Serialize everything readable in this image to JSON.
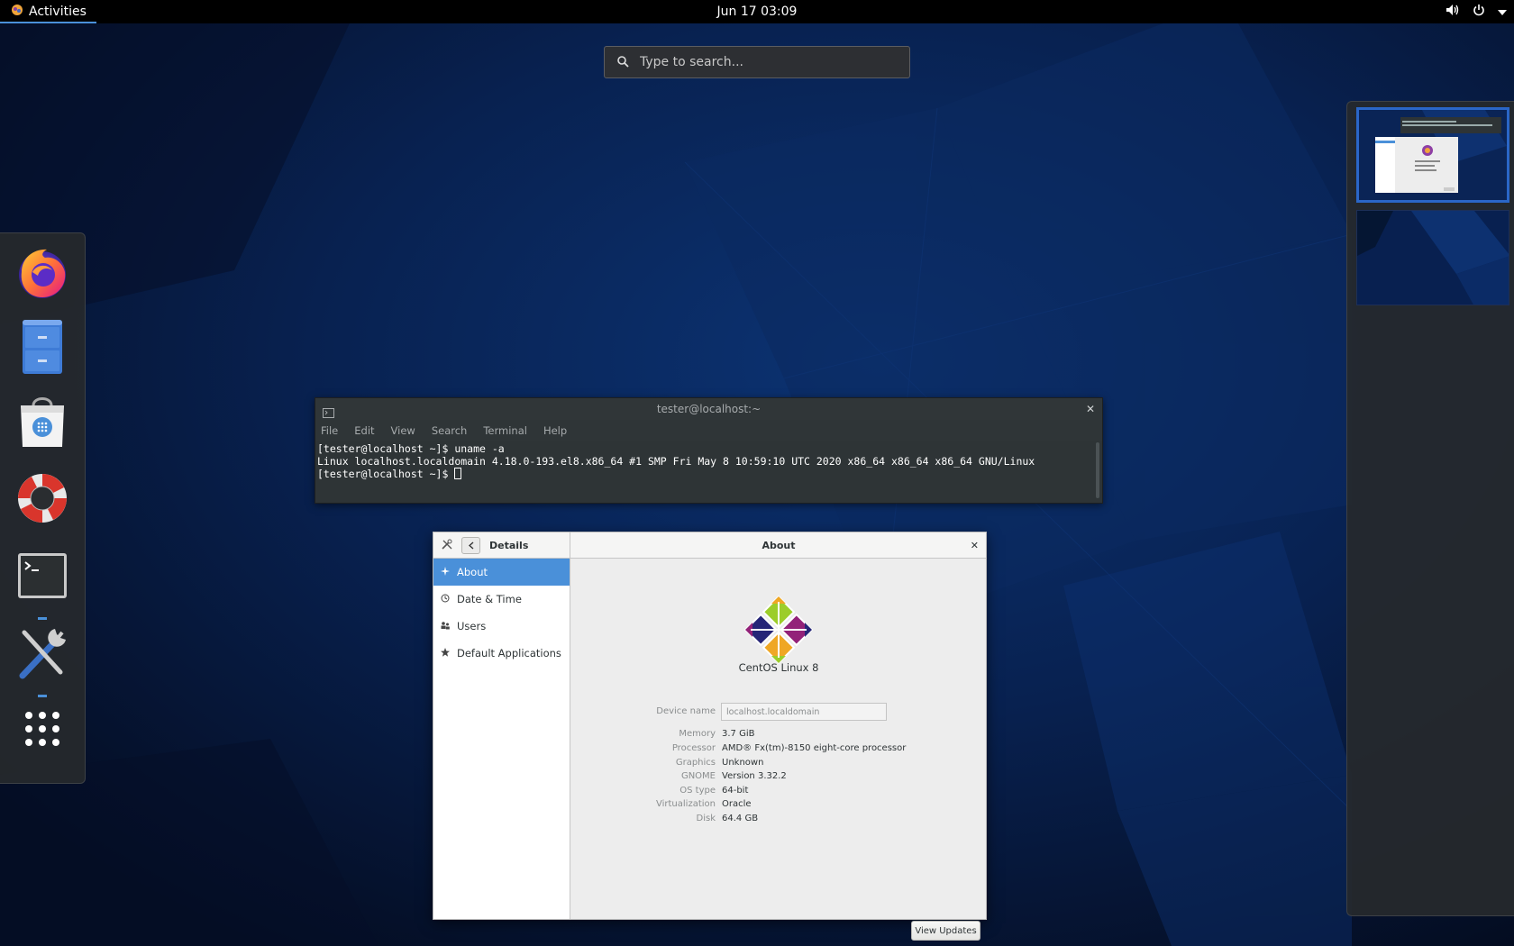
{
  "topbar": {
    "activities_label": "Activities",
    "clock": "Jun 17  03:09",
    "icons": [
      "gnome-foot-icon",
      "volume-icon",
      "power-icon",
      "caret-down-icon"
    ]
  },
  "search": {
    "placeholder": "Type to search..."
  },
  "dash": {
    "items": [
      {
        "name": "Firefox",
        "icon": "firefox-icon",
        "running": false
      },
      {
        "name": "Files",
        "icon": "files-cabinet-icon",
        "running": false
      },
      {
        "name": "Software",
        "icon": "software-bag-icon",
        "running": false
      },
      {
        "name": "Help",
        "icon": "lifebuoy-icon",
        "running": false
      },
      {
        "name": "Terminal",
        "icon": "terminal-icon",
        "running": true
      },
      {
        "name": "Settings",
        "icon": "tools-icon",
        "running": true
      },
      {
        "name": "Show Applications",
        "icon": "app-grid-icon",
        "running": false
      }
    ]
  },
  "workspaces": {
    "count": 2,
    "active_index": 0
  },
  "terminal": {
    "title": "tester@localhost:~",
    "menu": [
      "File",
      "Edit",
      "View",
      "Search",
      "Terminal",
      "Help"
    ],
    "lines": [
      "[tester@localhost ~]$ uname -a",
      "Linux localhost.localdomain 4.18.0-193.el8.x86_64 #1 SMP Fri May 8 10:59:10 UTC 2020 x86_64 x86_64 x86_64 GNU/Linux",
      "[tester@localhost ~]$ "
    ]
  },
  "settings": {
    "sidebar_title": "Details",
    "main_title": "About",
    "sidebar_items": [
      {
        "label": "About",
        "icon": "sparkle-icon",
        "active": true
      },
      {
        "label": "Date & Time",
        "icon": "clock-icon",
        "active": false
      },
      {
        "label": "Users",
        "icon": "users-icon",
        "active": false
      },
      {
        "label": "Default Applications",
        "icon": "star-icon",
        "active": false
      }
    ],
    "os_name": "CentOS Linux 8",
    "device_name_label": "Device name",
    "device_name_value": "localhost.localdomain",
    "info": [
      {
        "label": "Memory",
        "value": "3.7 GiB"
      },
      {
        "label": "Processor",
        "value": "AMD® Fx(tm)-8150 eight-core processor"
      },
      {
        "label": "Graphics",
        "value": "Unknown"
      },
      {
        "label": "GNOME",
        "value": "Version 3.32.2"
      },
      {
        "label": "OS type",
        "value": "64-bit"
      },
      {
        "label": "Virtualization",
        "value": "Oracle"
      },
      {
        "label": "Disk",
        "value": "64.4 GB"
      }
    ],
    "view_updates_label": "View Updates"
  },
  "colors": {
    "accent": "#4a90d9",
    "topbar": "#000000",
    "terminal_bg": "#2e3436",
    "background_dark": "#071535"
  }
}
